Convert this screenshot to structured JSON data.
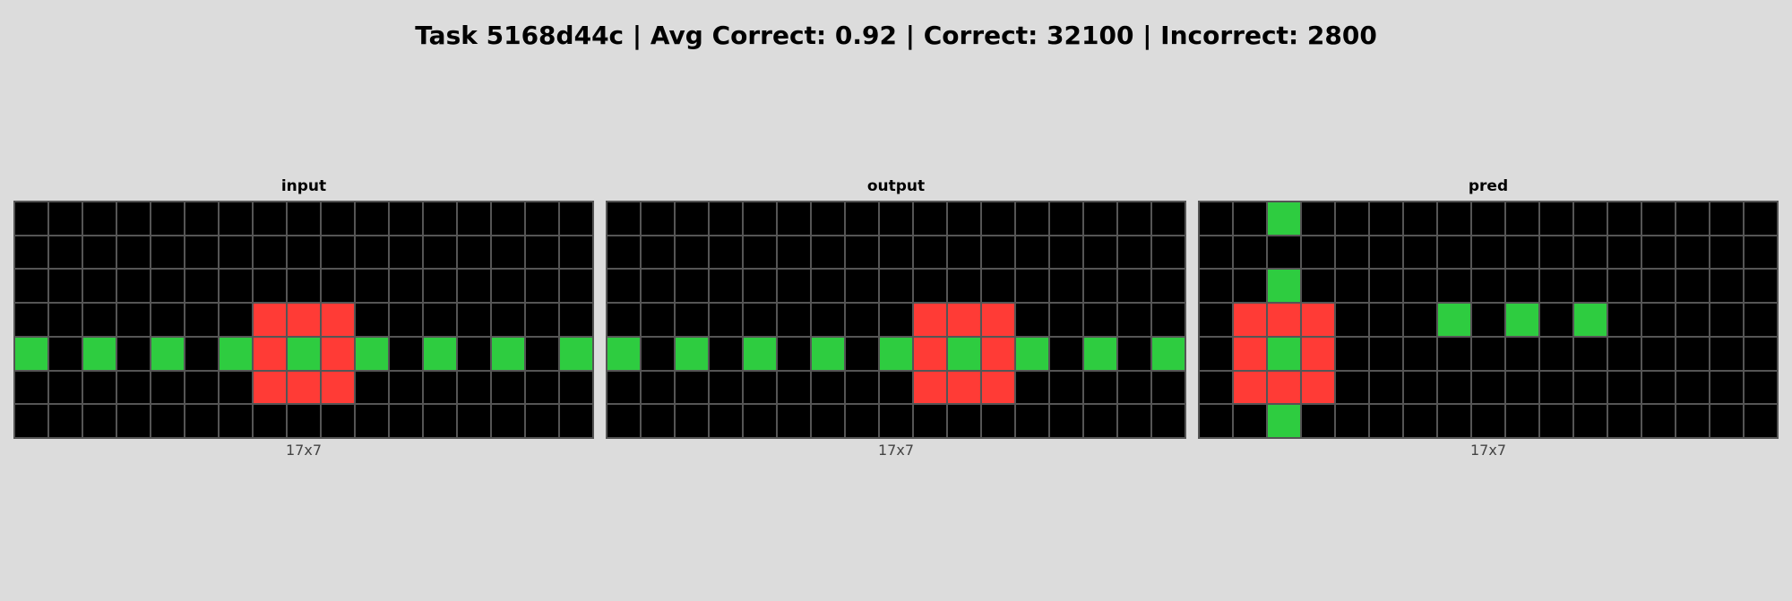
{
  "title": "Task 5168d44c | Avg Correct: 0.92 | Correct: 32100 | Incorrect: 2800",
  "palette": {
    "0": "#000000",
    "2": "#ff3b36",
    "3": "#2ecc40"
  },
  "panels": [
    {
      "title": "input",
      "dims": "17x7",
      "grid": [
        [
          0,
          0,
          0,
          0,
          0,
          0,
          0,
          0,
          0,
          0,
          0,
          0,
          0,
          0,
          0,
          0,
          0
        ],
        [
          0,
          0,
          0,
          0,
          0,
          0,
          0,
          0,
          0,
          0,
          0,
          0,
          0,
          0,
          0,
          0,
          0
        ],
        [
          0,
          0,
          0,
          0,
          0,
          0,
          0,
          0,
          0,
          0,
          0,
          0,
          0,
          0,
          0,
          0,
          0
        ],
        [
          0,
          0,
          0,
          0,
          0,
          0,
          0,
          2,
          2,
          2,
          0,
          0,
          0,
          0,
          0,
          0,
          0
        ],
        [
          3,
          0,
          3,
          0,
          3,
          0,
          3,
          2,
          3,
          2,
          3,
          0,
          3,
          0,
          3,
          0,
          3
        ],
        [
          0,
          0,
          0,
          0,
          0,
          0,
          0,
          2,
          2,
          2,
          0,
          0,
          0,
          0,
          0,
          0,
          0
        ],
        [
          0,
          0,
          0,
          0,
          0,
          0,
          0,
          0,
          0,
          0,
          0,
          0,
          0,
          0,
          0,
          0,
          0
        ]
      ]
    },
    {
      "title": "output",
      "dims": "17x7",
      "grid": [
        [
          0,
          0,
          0,
          0,
          0,
          0,
          0,
          0,
          0,
          0,
          0,
          0,
          0,
          0,
          0,
          0,
          0
        ],
        [
          0,
          0,
          0,
          0,
          0,
          0,
          0,
          0,
          0,
          0,
          0,
          0,
          0,
          0,
          0,
          0,
          0
        ],
        [
          0,
          0,
          0,
          0,
          0,
          0,
          0,
          0,
          0,
          0,
          0,
          0,
          0,
          0,
          0,
          0,
          0
        ],
        [
          0,
          0,
          0,
          0,
          0,
          0,
          0,
          0,
          0,
          2,
          2,
          2,
          0,
          0,
          0,
          0,
          0
        ],
        [
          3,
          0,
          3,
          0,
          3,
          0,
          3,
          0,
          3,
          2,
          3,
          2,
          3,
          0,
          3,
          0,
          3
        ],
        [
          0,
          0,
          0,
          0,
          0,
          0,
          0,
          0,
          0,
          2,
          2,
          2,
          0,
          0,
          0,
          0,
          0
        ],
        [
          0,
          0,
          0,
          0,
          0,
          0,
          0,
          0,
          0,
          0,
          0,
          0,
          0,
          0,
          0,
          0,
          0
        ]
      ]
    },
    {
      "title": "pred",
      "dims": "17x7",
      "grid": [
        [
          0,
          0,
          3,
          0,
          0,
          0,
          0,
          0,
          0,
          0,
          0,
          0,
          0,
          0,
          0,
          0,
          0
        ],
        [
          0,
          0,
          0,
          0,
          0,
          0,
          0,
          0,
          0,
          0,
          0,
          0,
          0,
          0,
          0,
          0,
          0
        ],
        [
          0,
          0,
          3,
          0,
          0,
          0,
          0,
          0,
          0,
          0,
          0,
          0,
          0,
          0,
          0,
          0,
          0
        ],
        [
          0,
          2,
          2,
          2,
          0,
          0,
          0,
          3,
          0,
          3,
          0,
          3,
          0,
          0,
          0,
          0,
          0
        ],
        [
          0,
          2,
          3,
          2,
          0,
          0,
          0,
          0,
          0,
          0,
          0,
          0,
          0,
          0,
          0,
          0,
          0
        ],
        [
          0,
          2,
          2,
          2,
          0,
          0,
          0,
          0,
          0,
          0,
          0,
          0,
          0,
          0,
          0,
          0,
          0
        ],
        [
          0,
          0,
          3,
          0,
          0,
          0,
          0,
          0,
          0,
          0,
          0,
          0,
          0,
          0,
          0,
          0,
          0
        ]
      ]
    }
  ]
}
